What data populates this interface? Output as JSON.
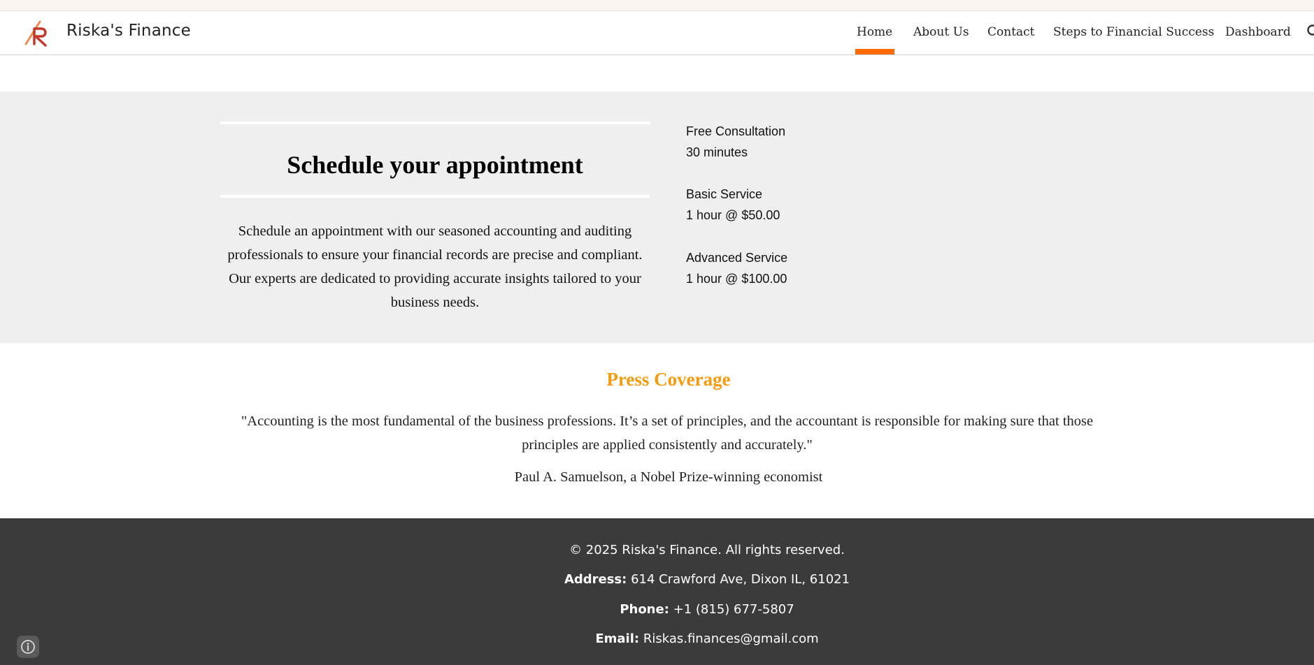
{
  "header": {
    "site_title": "Riska's Finance",
    "nav": [
      "Home",
      "About Us",
      "Contact",
      "Steps to Financial Success",
      "Dashboard"
    ],
    "active_nav": "Home",
    "accent_color": "#ff6a00"
  },
  "appointment": {
    "title": "Schedule your appointment",
    "description": "Schedule an appointment with our seasoned accounting and auditing professionals to ensure your financial records are precise and compliant. Our experts are dedicated to providing accurate insights tailored to your business needs.",
    "services": [
      {
        "name": "Free Consultation",
        "detail": "30 minutes"
      },
      {
        "name": "Basic Service",
        "detail": "1 hour @ $50.00"
      },
      {
        "name": "Advanced Service",
        "detail": "1 hour @ $100.00"
      }
    ]
  },
  "press": {
    "title": "Press Coverage",
    "title_color": "#f39c12",
    "quote": "\"Accounting is the most fundamental of the business professions. It’s a set of principles, and the accountant is responsible for making sure that those principles are applied consistently and accurately.\"",
    "attribution": "Paul A. Samuelson, a Nobel Prize-winning economist"
  },
  "footer": {
    "copyright": "© 2025 Riska's Finance. All rights reserved.",
    "address_label": "Address:",
    "address": "614 Crawford Ave, Dixon IL, 61021",
    "phone_label": "Phone:",
    "phone": "+1 (815) 677-5807",
    "email_label": "Email:",
    "email": "Riskas.finances@gmail.com"
  },
  "icons": [
    "logo-icon",
    "search-icon",
    "info-icon"
  ]
}
